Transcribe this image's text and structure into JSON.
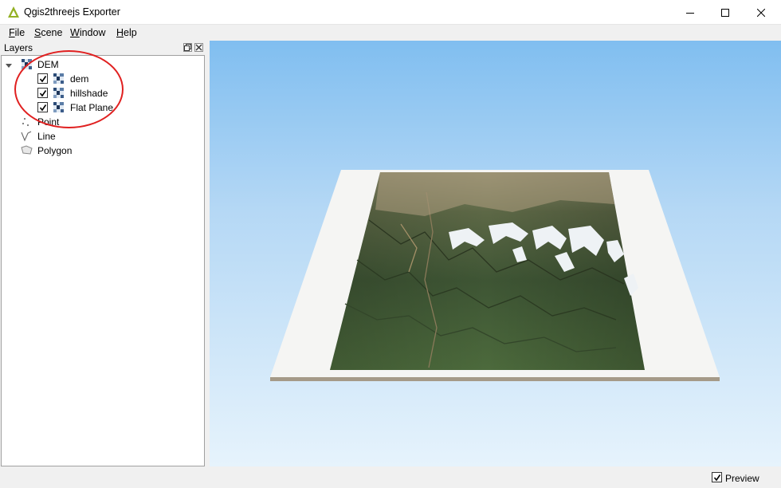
{
  "window": {
    "title": "Qgis2threejs Exporter"
  },
  "menu": [
    {
      "label": "File",
      "accel": "F",
      "rest": "ile"
    },
    {
      "label": "Scene",
      "accel": "S",
      "rest": "cene"
    },
    {
      "label": "Window",
      "accel": "W",
      "rest": "indow"
    },
    {
      "label": "Help",
      "accel": "H",
      "rest": "elp"
    }
  ],
  "layers_panel": {
    "title": "Layers",
    "groups": [
      {
        "label": "DEM",
        "expanded": true,
        "icon": "raster-icon",
        "children": [
          {
            "label": "dem",
            "checked": true,
            "icon": "raster-icon"
          },
          {
            "label": "hillshade",
            "checked": true,
            "icon": "raster-icon"
          },
          {
            "label": "Flat Plane",
            "checked": true,
            "icon": "raster-icon"
          }
        ]
      },
      {
        "label": "Point",
        "icon": "point-layer-icon"
      },
      {
        "label": "Line",
        "icon": "line-layer-icon"
      },
      {
        "label": "Polygon",
        "icon": "polygon-layer-icon"
      }
    ]
  },
  "annotation": {
    "color": "#e02020"
  },
  "viewport": {
    "sky_top": "#80bef0",
    "sky_bottom": "#e6f3fc",
    "plane_color": "#f5f5f3"
  },
  "statusbar": {
    "preview_label": "Preview",
    "preview_checked": true
  }
}
